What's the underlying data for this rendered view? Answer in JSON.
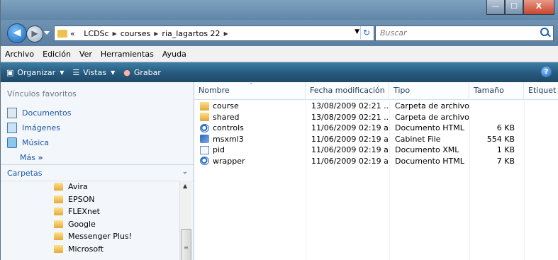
{
  "window": {
    "buttons": {
      "minimize": "—",
      "maximize": "☐",
      "close": "X"
    }
  },
  "address": {
    "crumbs": [
      "«",
      "LCDSc",
      "courses",
      "ria_lagartos 22"
    ],
    "search_placeholder": "Buscar"
  },
  "menu": [
    "Archivo",
    "Edición",
    "Ver",
    "Herramientas",
    "Ayuda"
  ],
  "toolbar": {
    "organize": "Organizar",
    "views": "Vistas",
    "burn": "Grabar",
    "help": "?"
  },
  "favorites": {
    "title": "Vínculos favoritos",
    "items": [
      {
        "label": "Documentos",
        "icon": "documents-icon"
      },
      {
        "label": "Imágenes",
        "icon": "pictures-icon"
      },
      {
        "label": "Música",
        "icon": "music-icon"
      }
    ],
    "more": "Más",
    "more_arrow": "»"
  },
  "folders": {
    "title": "Carpetas",
    "items": [
      "Avira",
      "EPSON",
      "FLEXnet",
      "Google",
      "Messenger Plus!",
      "Microsoft"
    ]
  },
  "columns": [
    "Nombre",
    "Fecha modificación",
    "Tipo",
    "Tamaño",
    "Etiquet"
  ],
  "files": [
    {
      "name": "course",
      "date": "13/08/2009 02:21 ...",
      "type": "Carpeta de archivos",
      "size": "",
      "icon": "folder"
    },
    {
      "name": "shared",
      "date": "13/08/2009 02:21 ...",
      "type": "Carpeta de archivos",
      "size": "",
      "icon": "folder"
    },
    {
      "name": "controls",
      "date": "11/06/2009 02:19 a...",
      "type": "Documento HTML",
      "size": "6 KB",
      "icon": "html"
    },
    {
      "name": "msxml3",
      "date": "11/06/2009 02:19 a...",
      "type": "Cabinet File",
      "size": "554 KB",
      "icon": "cab"
    },
    {
      "name": "pid",
      "date": "11/06/2009 02:19 a...",
      "type": "Documento XML",
      "size": "1 KB",
      "icon": "xml"
    },
    {
      "name": "wrapper",
      "date": "11/06/2009 02:19 a...",
      "type": "Documento HTML",
      "size": "7 KB",
      "icon": "html"
    }
  ]
}
